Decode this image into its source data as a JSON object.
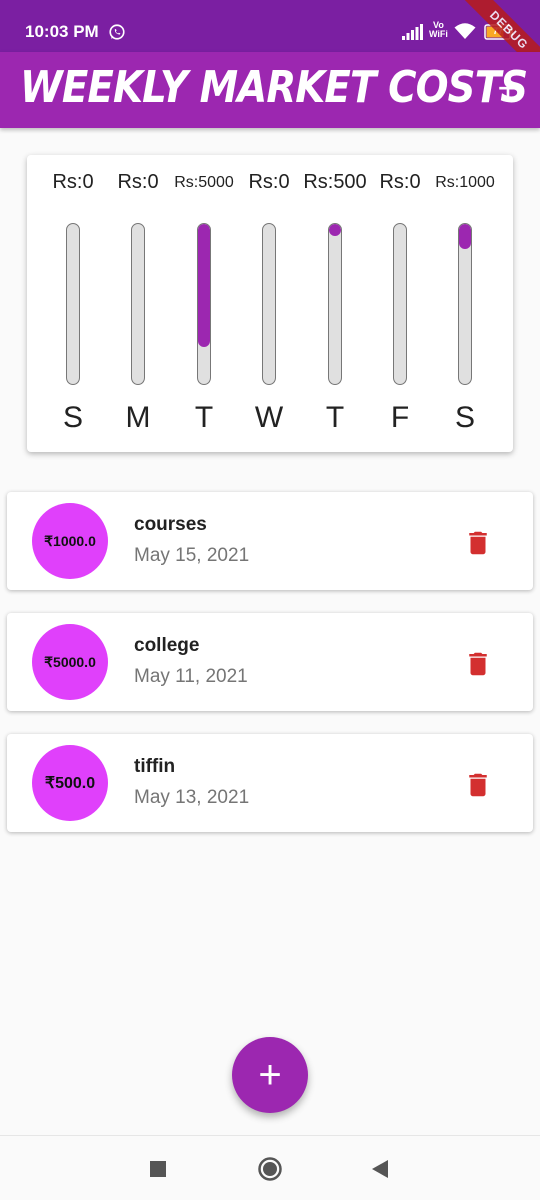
{
  "status_bar": {
    "time": "10:03 PM",
    "vo_top": "Vo",
    "vo_bottom": "WiFi",
    "battery": "77",
    "debug": "DEBUG",
    "icons": [
      "whatsapp-icon",
      "signal-icon",
      "wifi-icon",
      "battery-icon"
    ]
  },
  "app_bar": {
    "title": "Weekly Market Costs",
    "add_label": "+"
  },
  "chart": {
    "days": [
      {
        "amount": "Rs:0",
        "day": "S",
        "fraction": 0
      },
      {
        "amount": "Rs:0",
        "day": "M",
        "fraction": 0
      },
      {
        "amount": "Rs:5000",
        "day": "T",
        "fraction": 0.769
      },
      {
        "amount": "Rs:0",
        "day": "W",
        "fraction": 0
      },
      {
        "amount": "Rs:500",
        "day": "T",
        "fraction": 0.077
      },
      {
        "amount": "Rs:0",
        "day": "F",
        "fraction": 0
      },
      {
        "amount": "Rs:1000",
        "day": "S",
        "fraction": 0.154
      }
    ]
  },
  "transactions": [
    {
      "amount": "₹1000.0",
      "title": "courses",
      "date": "May 15, 2021"
    },
    {
      "amount": "₹5000.0",
      "title": "college",
      "date": "May 11, 2021"
    },
    {
      "amount": "₹500.0",
      "title": "tiffin",
      "date": "May 13, 2021"
    }
  ],
  "fab": {
    "label": "+"
  },
  "colors": {
    "primary": "#9c27b0",
    "primary_dark": "#7b1fa2",
    "accent": "#e040fb",
    "delete": "#d32f2f"
  }
}
